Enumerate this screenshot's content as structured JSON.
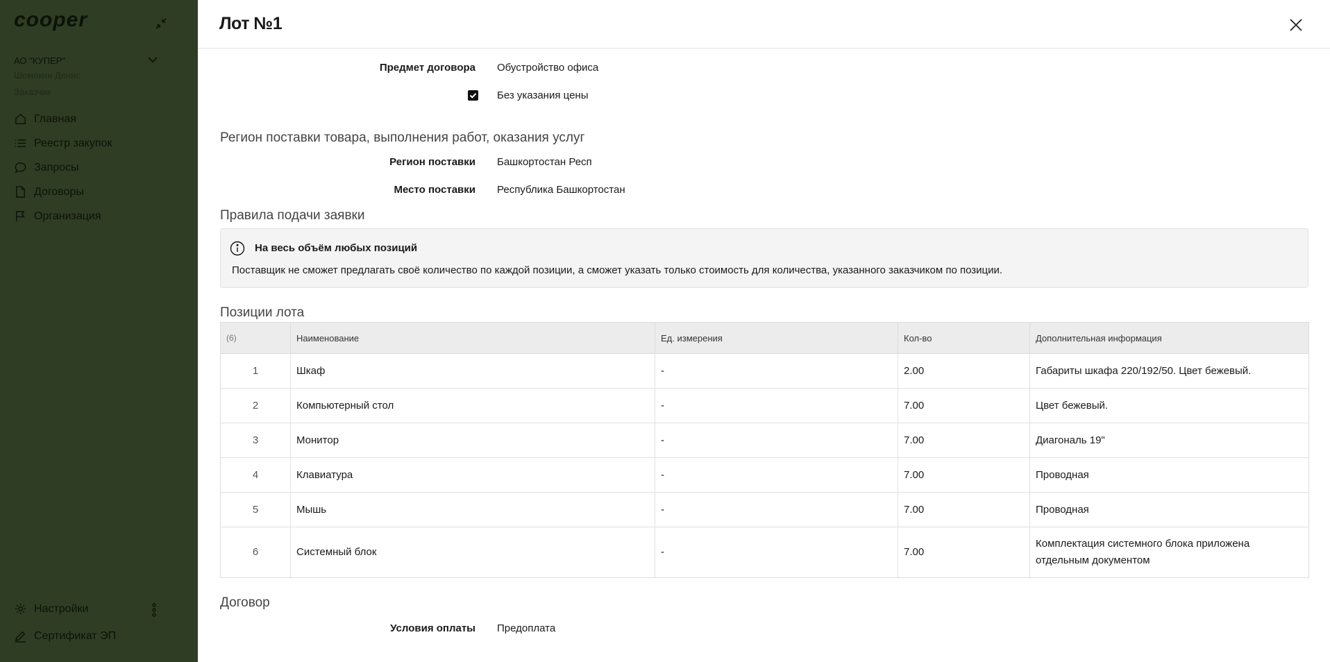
{
  "sidebar": {
    "logo": "cooper",
    "org_name": "АО \"КУПЕР\"",
    "user_name": "Шемякин Денис",
    "user_role": "Заказчик",
    "nav": [
      {
        "label": "Главная",
        "icon": "home-icon"
      },
      {
        "label": "Реестр закупок",
        "icon": "list-icon"
      },
      {
        "label": "Запросы",
        "icon": "chat-icon"
      },
      {
        "label": "Договоры",
        "icon": "document-icon"
      },
      {
        "label": "Организация",
        "icon": "flag-icon"
      }
    ],
    "bottom_nav": [
      {
        "label": "Настройки",
        "icon": "gear-icon"
      },
      {
        "label": "Сертификат ЭП",
        "icon": "signature-icon"
      }
    ]
  },
  "panel": {
    "title": "Лот №1",
    "subject_label": "Предмет договора",
    "subject_value": "Обустройство офиса",
    "no_price_label": "Без указания цены",
    "no_price_checked": true,
    "region_section": "Регион поставки товара, выполнения работ, оказания услуг",
    "region_label": "Регион поставки",
    "region_value": "Башкортостан Респ",
    "place_label": "Место поставки",
    "place_value": "Республика Башкортостан",
    "rules_section": "Правила подачи заявки",
    "rules_title": "На весь объём любых позиций",
    "rules_text": "Поставщик не сможет предлагать своё количество по каждой позиции, а сможет указать только стоимость для количества, указанного заказчиком по позиции.",
    "positions_section": "Позиции лота",
    "table": {
      "headers": [
        "(6)",
        "Наименование",
        "Ед. измерения",
        "Кол-во",
        "Дополнительная информация"
      ],
      "rows": [
        [
          "1",
          "Шкаф",
          "-",
          "2.00",
          "Габариты шкафа 220/192/50. Цвет бежевый."
        ],
        [
          "2",
          "Компьютерный стол",
          "-",
          "7.00",
          "Цвет бежевый."
        ],
        [
          "3",
          "Монитор",
          "-",
          "7.00",
          "Диагональ 19\""
        ],
        [
          "4",
          "Клавиатура",
          "-",
          "7.00",
          "Проводная"
        ],
        [
          "5",
          "Мышь",
          "-",
          "7.00",
          "Проводная"
        ],
        [
          "6",
          "Системный блок",
          "-",
          "7.00",
          "Комплектация системного блока приложена отдельным документом"
        ]
      ]
    },
    "contract_section": "Договор",
    "payment_label": "Условия оплаты",
    "payment_value": "Предоплата"
  }
}
